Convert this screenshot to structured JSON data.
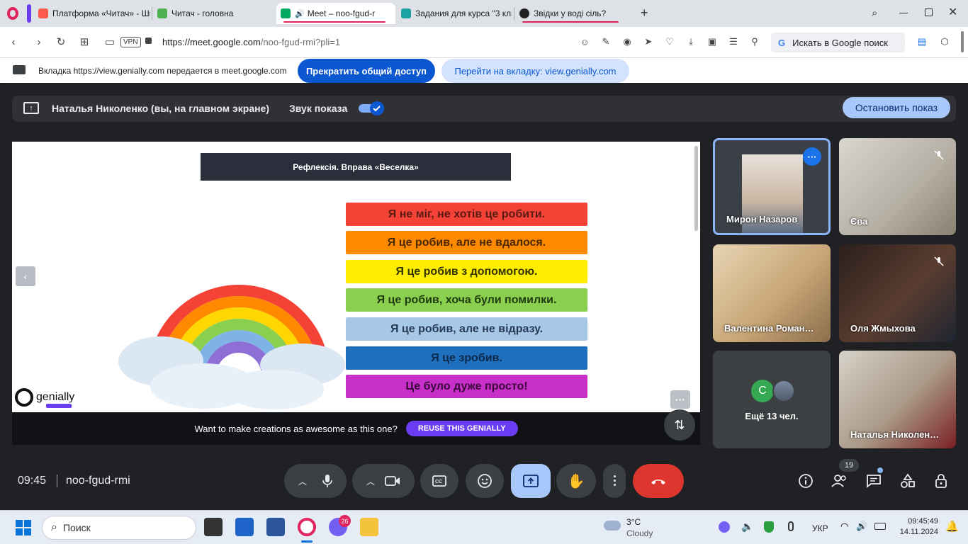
{
  "browser": {
    "tabs": [
      {
        "title": "Платформа «Читач» - Шк",
        "fav_color": "#ff5a4f"
      },
      {
        "title": "Читач - головна",
        "fav_color": "#4caf50"
      },
      {
        "title": "Meet – noo-fgud-r",
        "fav_color": "#00a862",
        "active": true
      },
      {
        "title": "Задания для курса \"3 кла",
        "fav_color": "#1aa3a3"
      },
      {
        "title": "Звідки у воді сіль?",
        "fav_color": "#222222"
      }
    ],
    "new_tab": "+",
    "url_host": "https://meet.google.com",
    "url_path": "/noo-fgud-rmi?pli=1",
    "vpn": "VPN",
    "search_label": "Искать в Google поиск",
    "search_g": "G"
  },
  "share": {
    "notice": "Вкладка https://view.genially.com передается в meet.google.com",
    "stop_label": "Прекратить общий доступ",
    "switch_label": "Перейти на вкладку: view.genially.com"
  },
  "presenting": {
    "label": "Наталья Николенко (вы, на главном экране)",
    "sound_label": "Звук показа",
    "stop_label": "Остановить показ"
  },
  "slide": {
    "title": "Рефлексія. Вправа «Веселка»",
    "bars": [
      {
        "text": "Я не міг, не хотів це робити.",
        "color": "#f44336",
        "fg": "#5a1a12"
      },
      {
        "text": "Я це робив, але не вдалося.",
        "color": "#ff8a00",
        "fg": "#4a2a00"
      },
      {
        "text": "Я це робив з допомогою.",
        "color": "#ffee00",
        "fg": "#333300"
      },
      {
        "text": "Я це робив, хоча були помилки.",
        "color": "#8bcf4e",
        "fg": "#1f3a10"
      },
      {
        "text": "Я це робив, але не відразу.",
        "color": "#a7c7e7",
        "fg": "#243a55"
      },
      {
        "text": "Я це зробив.",
        "color": "#1f6fbf",
        "fg": "#0b2a4a"
      },
      {
        "text": "Це було дуже просто!",
        "color": "#c82fc8",
        "fg": "#3a0b3a"
      }
    ],
    "brand": "genially",
    "cta_text": "Want to make creations as awesome as this one?",
    "cta_button": "REUSE THIS GENIALLY"
  },
  "participants": [
    {
      "name": "Мирон Назаров",
      "muted": false,
      "speaking": true
    },
    {
      "name": "Єва",
      "muted": true
    },
    {
      "name": "Валентина Роман…",
      "muted": false
    },
    {
      "name": "Оля Жмыхова",
      "muted": true
    },
    {
      "name": "Ещё 13 чел.",
      "avatar_letter": "C"
    },
    {
      "name": "Наталья Николен…",
      "muted": false
    }
  ],
  "meeting": {
    "time": "09:45",
    "code": "noo-fgud-rmi",
    "people_count": "19"
  },
  "taskbar": {
    "search": "Поиск",
    "viber_badge": "26",
    "weather_temp": "3°C",
    "weather_cond": "Cloudy",
    "lang": "УКР",
    "time": "09:45:49",
    "date": "14.11.2024"
  }
}
